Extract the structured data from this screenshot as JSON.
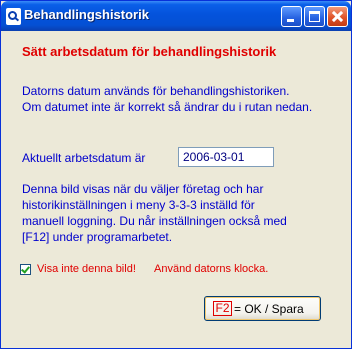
{
  "window": {
    "title": "Behandlingshistorik"
  },
  "content": {
    "heading": "Sätt arbetsdatum för behandlingshistorik",
    "info_lines": [
      "Datorns datum används för behandlingshistoriken.",
      "Om datumet inte är korrekt så ändrar du i rutan nedan."
    ],
    "date_label": "Aktuellt arbetsdatum är",
    "date_value": "2006-03-01",
    "note_lines": [
      "Denna bild visas när du väljer företag och har",
      "historikinställningen i meny 3-3-3 inställd för",
      "manuell loggning. Du når inställningen också med",
      "[F12] under programarbetet."
    ],
    "checkbox_label": "Visa inte denna bild!",
    "checkbox_checked": true,
    "clock_text": "Använd datorns klocka.",
    "ok_key": "F2",
    "ok_label": "= OK / Spara"
  },
  "colors": {
    "heading": "#e00000",
    "info_text": "#0000cc",
    "titlebar": "#0453dc",
    "dialog_bg": "#ece9d8"
  },
  "icons": {
    "app": "magnifier-app-icon",
    "minimize": "minimize-icon",
    "maximize": "maximize-icon",
    "close": "close-icon",
    "checkbox": "checkmark-icon"
  }
}
